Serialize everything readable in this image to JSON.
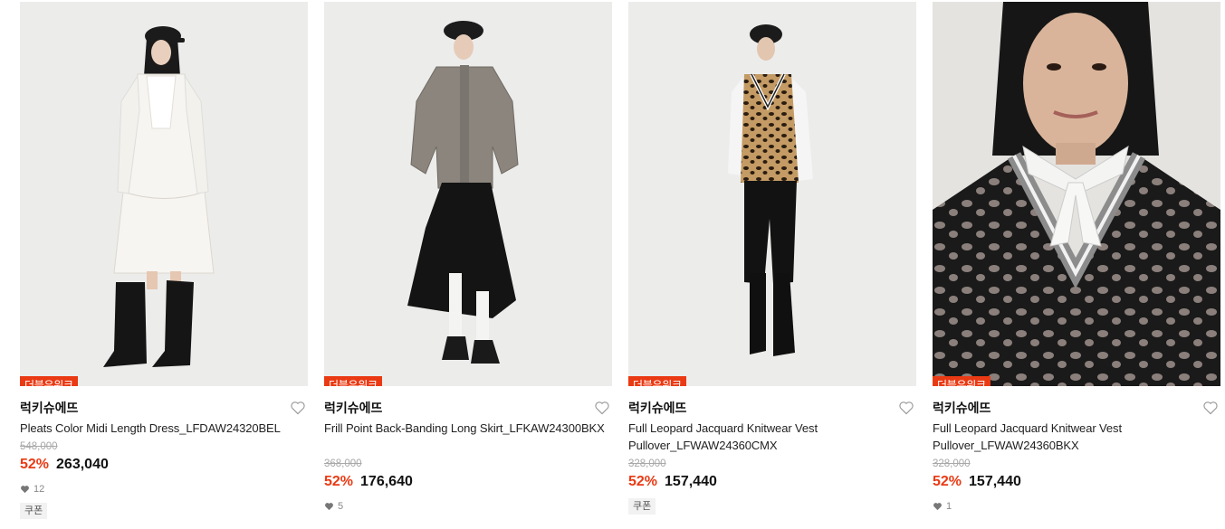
{
  "products": [
    {
      "badge": "더블유위크",
      "brand": "럭키슈에뜨",
      "name": "Pleats Color Midi Length Dress_LFDAW24320BEL",
      "original_price": "548,000",
      "discount": "52%",
      "price": "263,040",
      "likes": "12",
      "coupon": "쿠폰",
      "image_icon": "product-photo-dress"
    },
    {
      "badge": "더블유위크",
      "brand": "럭키슈에뜨",
      "name": "Frill Point Back-Banding Long Skirt_LFKAW24300BKX",
      "original_price": "368,000",
      "discount": "52%",
      "price": "176,640",
      "likes": "5",
      "coupon": "",
      "image_icon": "product-photo-skirt"
    },
    {
      "badge": "더블유위크",
      "brand": "럭키슈에뜨",
      "name": "Full Leopard Jacquard Knitwear Vest Pullover_LFWAW24360CMX",
      "original_price": "328,000",
      "discount": "52%",
      "price": "157,440",
      "likes": "",
      "coupon": "쿠폰",
      "image_icon": "product-photo-leopard-vest"
    },
    {
      "badge": "더블유위크",
      "brand": "럭키슈에뜨",
      "name": "Full Leopard Jacquard Knitwear Vest Pullover_LFWAW24360BKX",
      "original_price": "328,000",
      "discount": "52%",
      "price": "157,440",
      "likes": "1",
      "coupon": "",
      "image_icon": "product-photo-leopard-vest-closeup"
    }
  ],
  "colors": {
    "accent": "#ea3a14",
    "photo_background": "#ececeb"
  },
  "icons": {
    "wishlist": "heart-outline-icon",
    "likes": "heart-filled-icon"
  }
}
